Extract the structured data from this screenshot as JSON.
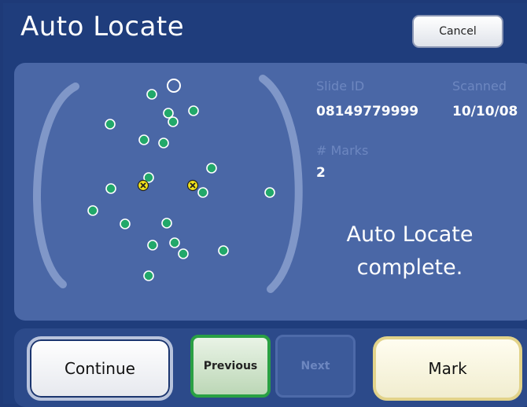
{
  "header": {
    "title": "Auto Locate",
    "cancel_label": "Cancel"
  },
  "slide_info": {
    "slide_id_label": "Slide ID",
    "slide_id_value": "08149779999",
    "scanned_label": "Scanned",
    "scanned_value": "10/10/08",
    "marks_label": "# Marks",
    "marks_value": "2"
  },
  "status": {
    "line1": "Auto Locate",
    "line2": "complete."
  },
  "buttons": {
    "continue_label": "Continue",
    "previous_label": "Previous",
    "next_label": "Next",
    "mark_label": "Mark"
  },
  "colors": {
    "background": "#1f3d7c",
    "panel": "#4a67a6",
    "object_fill": "#22a86a",
    "mark_fill": "#f2e21a",
    "bracket": "#8097c8"
  },
  "slide": {
    "object_count": 26,
    "marked_count": 2
  }
}
